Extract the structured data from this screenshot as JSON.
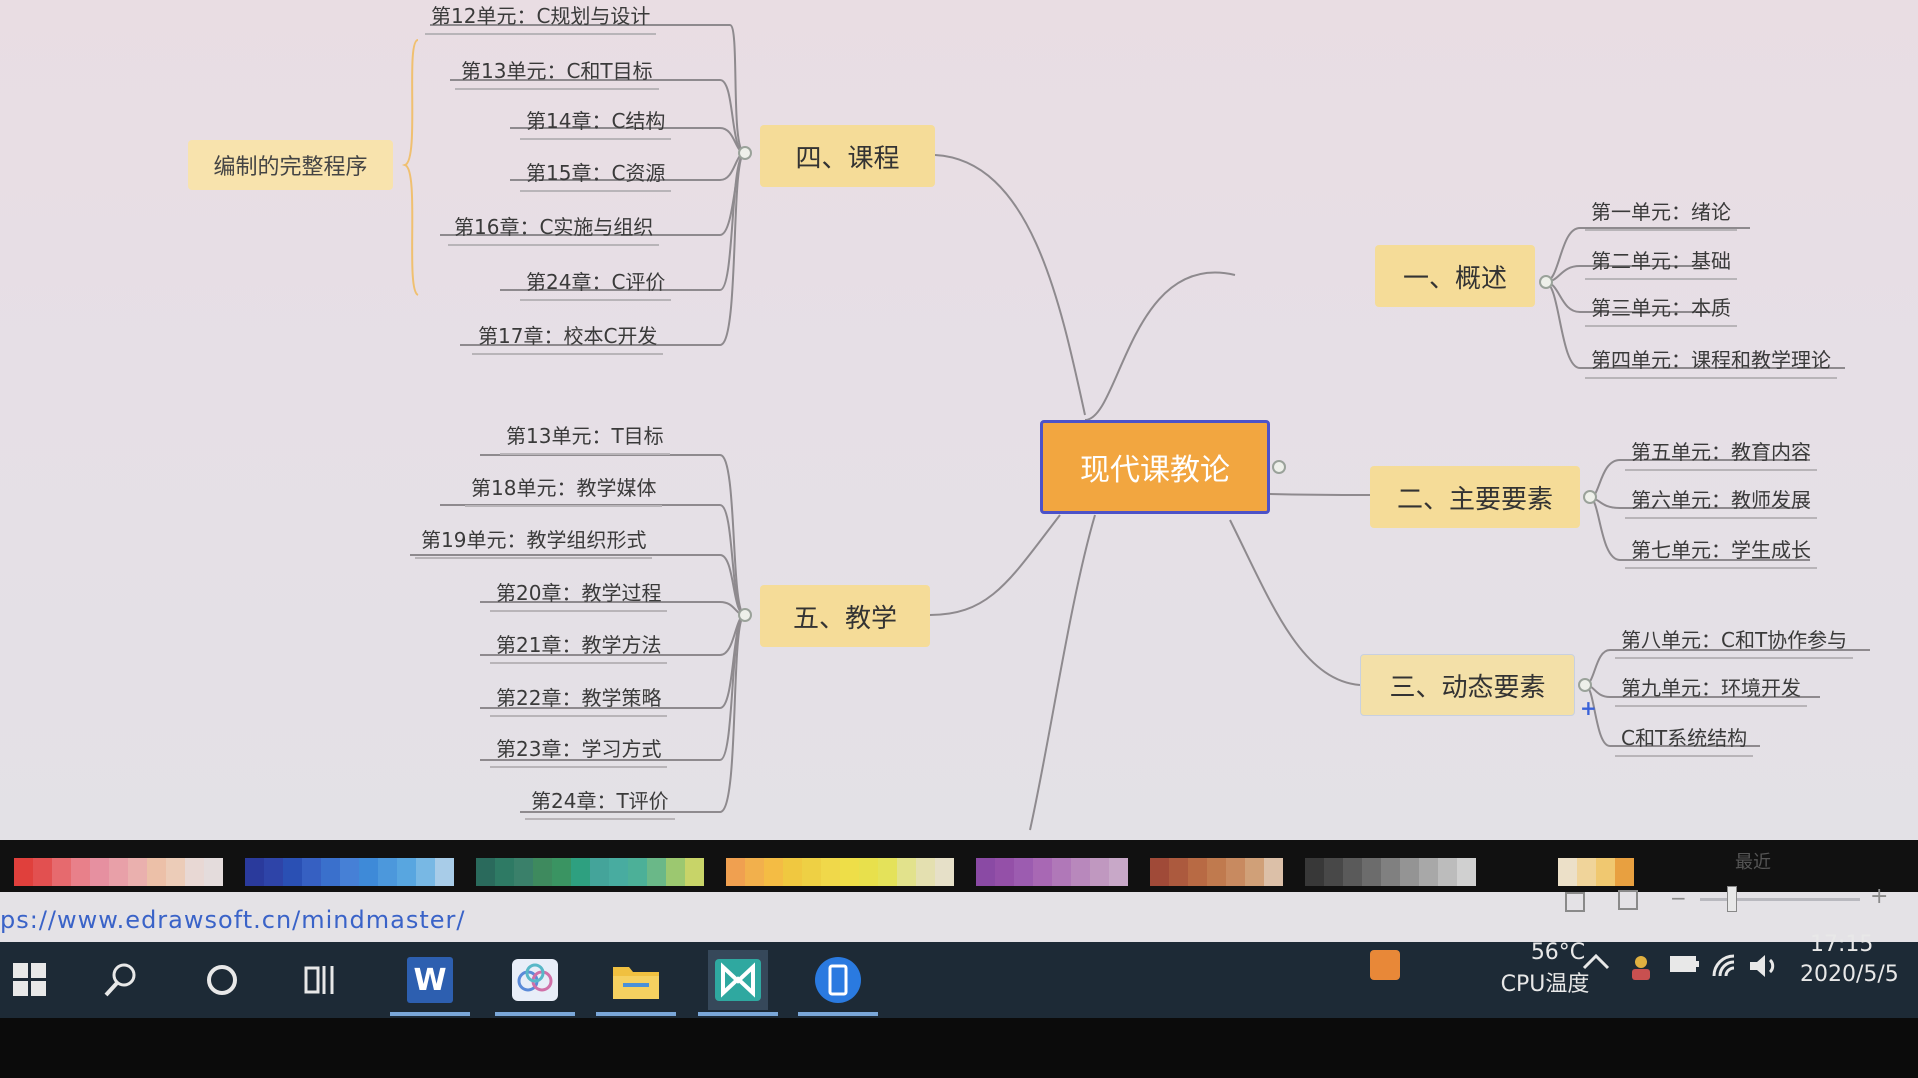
{
  "mindmap": {
    "center": "现代课教论",
    "branch1": {
      "title": "一、概述",
      "items": [
        "第一单元：绪论",
        "第二单元：基础",
        "第三单元：本质",
        "第四单元：课程和教学理论"
      ]
    },
    "branch2": {
      "title": "二、主要要素",
      "items": [
        "第五单元：教育内容",
        "第六单元：教师发展",
        "第七单元：学生成长"
      ]
    },
    "branch3": {
      "title": "三、动态要素",
      "items": [
        "第八单元：C和T协作参与",
        "第九单元：环境开发",
        "C和T系统结构"
      ]
    },
    "branch4": {
      "title": "四、课程",
      "items": [
        "第12单元：C规划与设计",
        "第13单元：C和T目标",
        "第14章：C结构",
        "第15章：C资源",
        "第16章：C实施与组织",
        "第24章：C评价",
        "第17章：校本C开发"
      ],
      "callout": "编制的完整程序"
    },
    "branch5": {
      "title": "五、教学",
      "items": [
        "第13单元：T目标",
        "第18单元：教学媒体",
        "第19单元：教学组织形式",
        "第20章：教学过程",
        "第21章：教学方法",
        "第22章：教学策略",
        "第23章：学习方式",
        "第24章：T评价"
      ]
    }
  },
  "palette": {
    "groups": [
      [
        "#e0403c",
        "#e25050",
        "#e66a6e",
        "#e8808a",
        "#e690a0",
        "#e8a0a8",
        "#eab0ae",
        "#ecc0a8",
        "#ecccb8",
        "#e8d8d4",
        "#e4dcdc"
      ],
      [
        "#2a3a9c",
        "#2e44a8",
        "#2a50b4",
        "#3660c2",
        "#3a70cc",
        "#4680d6",
        "#3e8ad8",
        "#4c98dc",
        "#58a6e0",
        "#78b8e4",
        "#a8cce8"
      ],
      [
        "#2a6a5c",
        "#2e7a64",
        "#3a806a",
        "#3e8a5e",
        "#3a9462",
        "#2ea080",
        "#44a49a",
        "#48aca0",
        "#4cb098",
        "#6ab888",
        "#9cc870",
        "#c8d468"
      ],
      [
        "#f0a050",
        "#f2b04c",
        "#f4bc44",
        "#f0c840",
        "#eed044",
        "#f0d84a",
        "#eede48",
        "#e8e04c",
        "#e4e25a",
        "#e2e28c",
        "#e4e0b0",
        "#e6e0c8"
      ],
      [
        "#8a4aa4",
        "#9450a8",
        "#9c5cb0",
        "#a868b4",
        "#b078b8",
        "#b888bc",
        "#c098c0",
        "#c8a8c8"
      ],
      [
        "#a04a38",
        "#ac5a3e",
        "#b86a44",
        "#c07a4e",
        "#c88a60",
        "#d0a078",
        "#dcc0a8"
      ],
      [
        "#383838",
        "#484848",
        "#5a5a5a",
        "#6c6c6c",
        "#808080",
        "#949494",
        "#a8a8a8",
        "#bcbcbc",
        "#d0d0d0"
      ]
    ],
    "recent_label": "最近",
    "recent": [
      "#ece0c8",
      "#f0d49a",
      "#f0c870",
      "#e8a040"
    ]
  },
  "status": {
    "url": "ps://www.edrawsoft.cn/mindmaster/"
  },
  "taskbar": {
    "apps": [
      "windows-start",
      "search",
      "cortana",
      "task-view",
      "word",
      "cloud-app",
      "file-explorer",
      "mindmaster",
      "tablet-app"
    ],
    "word_label": "W",
    "cpu_temp": "56°C",
    "cpu_label": "CPU温度",
    "time": "17:15",
    "date": "2020/5/5"
  }
}
